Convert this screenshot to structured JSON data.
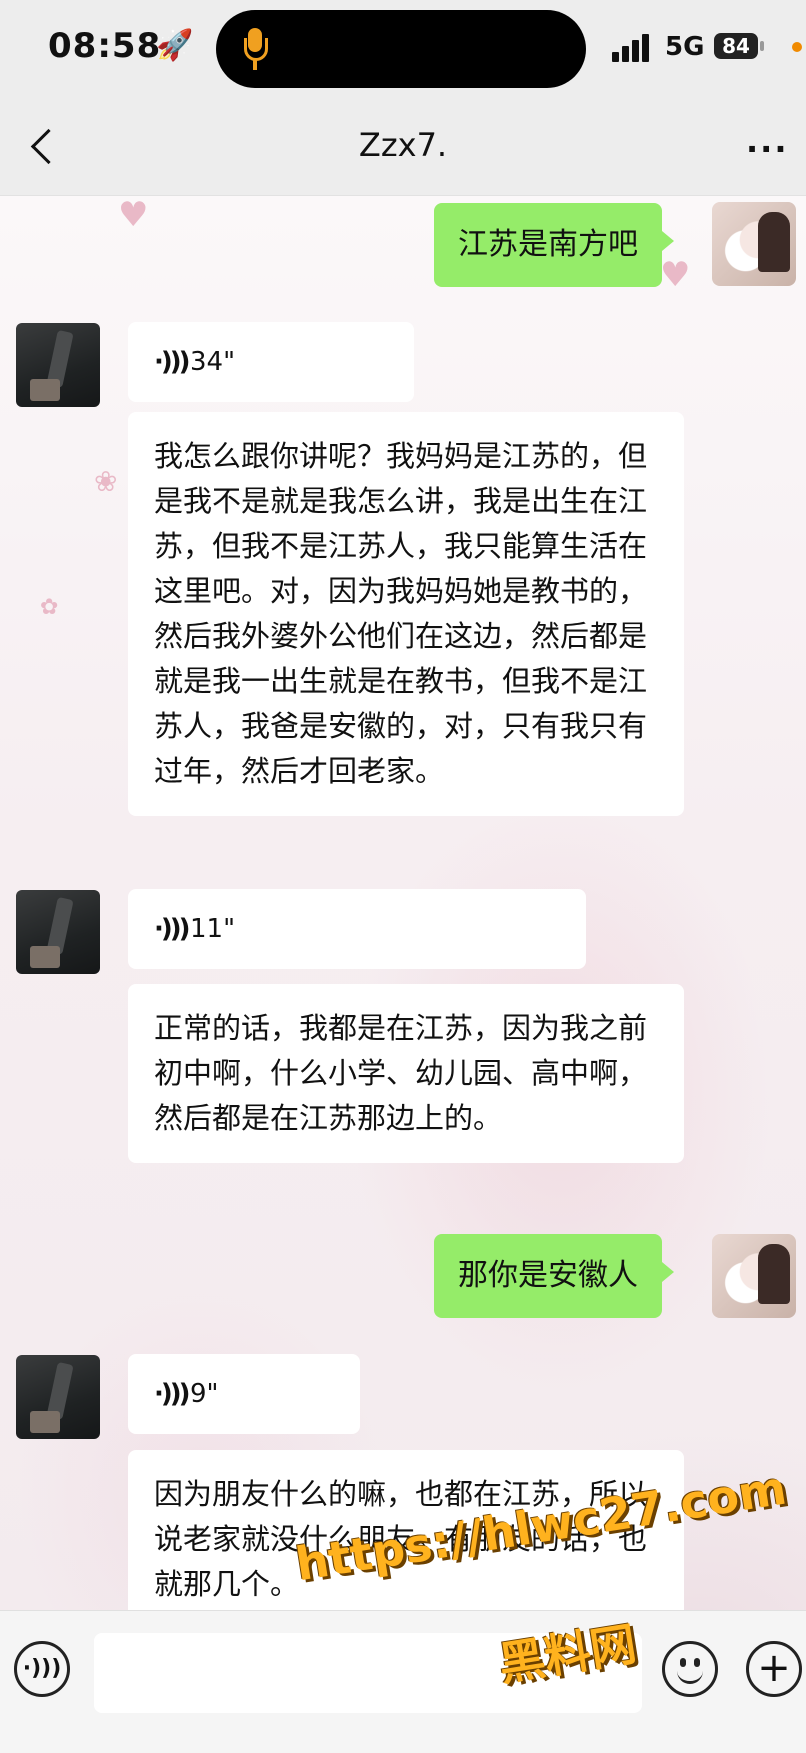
{
  "status_bar": {
    "time": "08:58",
    "network": "5G",
    "battery": "84",
    "icons": [
      "rocket-icon",
      "microphone-icon",
      "signal-icon",
      "battery-icon"
    ]
  },
  "header": {
    "title": "Zzx7.",
    "back_icon": "chevron-left-icon",
    "more_icon": "more-icon"
  },
  "messages": [
    {
      "sender": "self",
      "type": "text",
      "text": "江苏是南方吧"
    },
    {
      "sender": "other",
      "type": "voice",
      "duration": "34\""
    },
    {
      "sender": "other",
      "type": "transcript",
      "text": "我怎么跟你讲呢？我妈妈是江苏的，但是我不是就是我怎么讲，我是出生在江苏，但我不是江苏人，我只能算生活在这里吧。对，因为我妈妈她是教书的，然后我外婆外公他们在这边，然后都是就是我一出生就是在教书，但我不是江苏人，我爸是安徽的，对，只有我只有过年，然后才回老家。"
    },
    {
      "sender": "other",
      "type": "voice",
      "duration": "11\""
    },
    {
      "sender": "other",
      "type": "transcript",
      "text": "正常的话，我都是在江苏，因为我之前初中啊，什么小学、幼儿园、高中啊，然后都是在江苏那边上的。"
    },
    {
      "sender": "self",
      "type": "text",
      "text": "那你是安徽人"
    },
    {
      "sender": "other",
      "type": "voice",
      "duration": "9\""
    },
    {
      "sender": "other",
      "type": "transcript",
      "text": "因为朋友什么的嘛，也都在江苏，所以说老家就没什么朋友。有朋友的话，也就那几个。"
    }
  ],
  "input_bar": {
    "icons": [
      "voice-input-icon",
      "emoji-icon",
      "plus-icon"
    ]
  },
  "watermark": {
    "url": "https://hlwc27.com",
    "name": "黑料网"
  },
  "colors": {
    "self_bubble": "#95ec69",
    "other_bubble": "#ffffff",
    "bar_background": "#ededed",
    "watermark": "#ffb21e"
  }
}
